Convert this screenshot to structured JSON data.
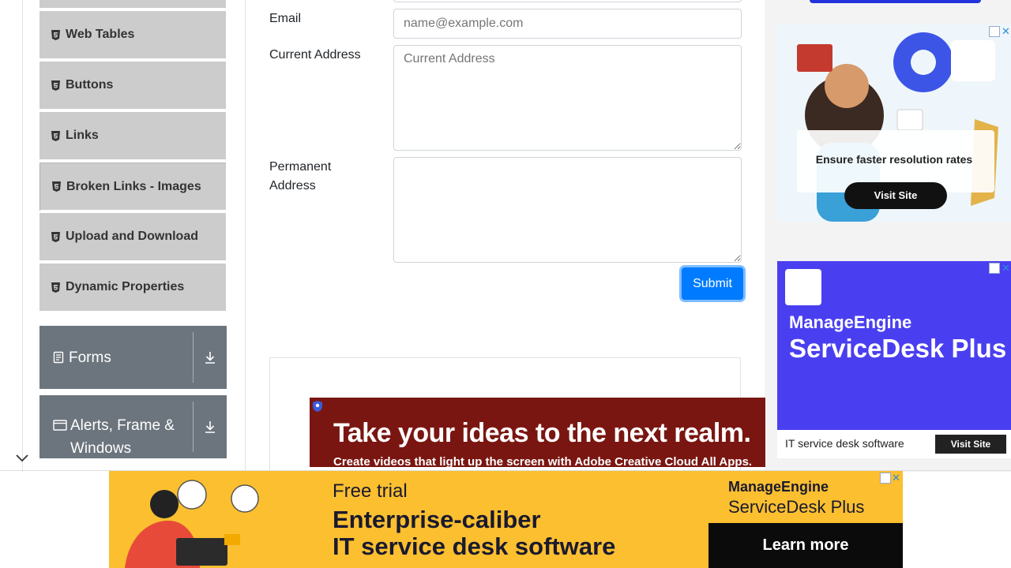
{
  "sidebar": {
    "items": [
      {
        "label": "Web Tables"
      },
      {
        "label": "Buttons"
      },
      {
        "label": "Links"
      },
      {
        "label": "Broken Links - Images"
      },
      {
        "label": "Upload and Download"
      },
      {
        "label": "Dynamic Properties"
      }
    ],
    "groups": [
      {
        "label": "Forms",
        "icon": "form-icon"
      },
      {
        "label": "Alerts, Frame & Windows",
        "icon": "window-icon"
      }
    ]
  },
  "form": {
    "email_label": "Email",
    "email_placeholder": "name@example.com",
    "current_address_label": "Current Address",
    "current_address_placeholder": "Current Address",
    "permanent_address_label": "Permanent Address",
    "submit_label": "Submit"
  },
  "ads": {
    "wide": {
      "headline": "Take your ideas to the next realm.",
      "sub": "Create videos that light up the screen with Adobe Creative Cloud All Apps."
    },
    "side1": {
      "brand": "ManageEngine ServiceDesk Plus",
      "tagline": "Ensure faster resolution rates",
      "cta": "Visit Site"
    },
    "side2": {
      "brand_top": "ManageEngine",
      "brand_main": "ServiceDesk Plus",
      "tagline": "IT service desk software",
      "cta": "Visit Site"
    },
    "banner": {
      "free": "Free trial",
      "line1": "Enterprise-caliber",
      "line2": "IT service desk software",
      "brand_top": "ManageEngine",
      "brand_main": "ServiceDesk Plus",
      "cta": "Learn more"
    }
  },
  "colors": {
    "accent": "#007bff",
    "menu_bg": "#cccccc",
    "group_bg": "#6c757d"
  }
}
